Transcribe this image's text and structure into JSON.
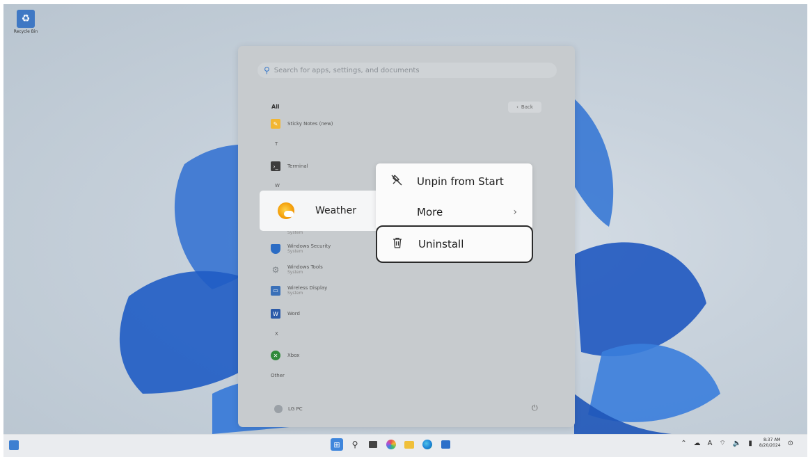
{
  "desktop": {
    "recycle_bin_label": "Recycle Bin"
  },
  "start_menu": {
    "search_placeholder": "Search for apps, settings, and documents",
    "back_label": "Back",
    "all_header": "All",
    "apps": [
      {
        "label": "Sticky Notes (new)",
        "subtitle": "",
        "icon": "sticky-notes-icon",
        "color": "#f2b632"
      },
      {
        "letter": "T"
      },
      {
        "label": "Terminal",
        "subtitle": "",
        "icon": "terminal-icon",
        "color": "#3c3c3c"
      },
      {
        "letter": "W"
      },
      {
        "label": "Windows Security",
        "subtitle": "System",
        "icon": "shield-icon",
        "color": "#2b6cc4"
      },
      {
        "label": "Windows Tools",
        "subtitle": "System",
        "icon": "gear-icon",
        "color": "#8e9499"
      },
      {
        "label": "Wireless Display",
        "subtitle": "System",
        "icon": "display-icon",
        "color": "#3a70b8"
      },
      {
        "label": "Word",
        "subtitle": "",
        "icon": "word-icon",
        "color": "#2b5aa8"
      },
      {
        "letter": "X"
      },
      {
        "label": "Xbox",
        "subtitle": "",
        "icon": "xbox-icon",
        "color": "#2f8a3a"
      },
      {
        "letter": "Other"
      }
    ],
    "hidden_subtitle": "System",
    "user_name": "LG PC"
  },
  "weather_tile": {
    "label": "Weather",
    "icon": "weather-icon"
  },
  "context_menu": {
    "unpin_label": "Unpin from Start",
    "more_label": "More",
    "uninstall_label": "Uninstall"
  },
  "taskbar": {
    "time": "8:37 AM",
    "date": "8/20/2024",
    "ime": "A"
  }
}
